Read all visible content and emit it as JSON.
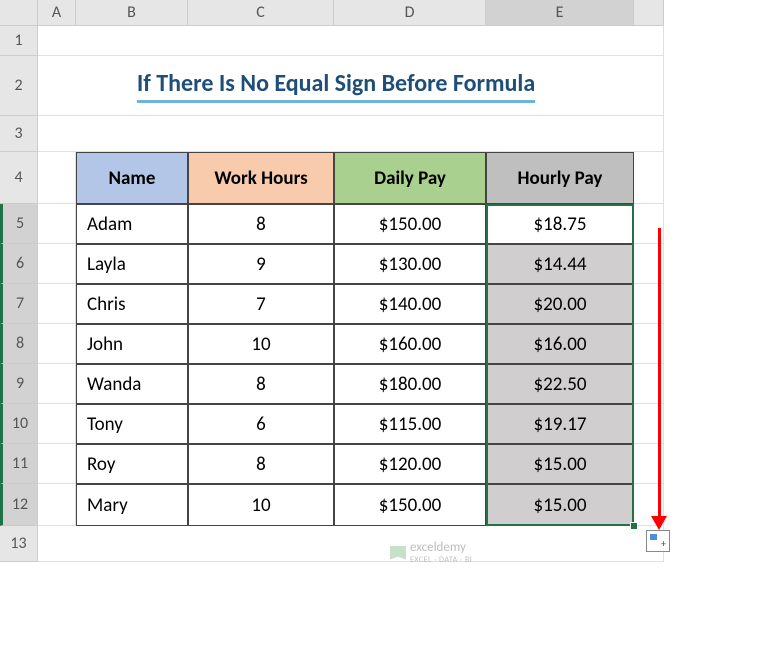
{
  "cols": [
    "A",
    "B",
    "C",
    "D",
    "E",
    ""
  ],
  "rows": [
    "1",
    "2",
    "3",
    "4",
    "5",
    "6",
    "7",
    "8",
    "9",
    "10",
    "11",
    "12",
    "13"
  ],
  "title": "If There Is No Equal Sign Before Formula",
  "headers": {
    "name": "Name",
    "work": "Work Hours",
    "daily": "Daily Pay",
    "hourly": "Hourly Pay"
  },
  "data": [
    {
      "name": "Adam",
      "work": "8",
      "daily": "$150.00",
      "hourly": "$18.75",
      "gray": false
    },
    {
      "name": "Layla",
      "work": "9",
      "daily": "$130.00",
      "hourly": "$14.44",
      "gray": true
    },
    {
      "name": "Chris",
      "work": "7",
      "daily": "$140.00",
      "hourly": "$20.00",
      "gray": true
    },
    {
      "name": "John",
      "work": "10",
      "daily": "$160.00",
      "hourly": "$16.00",
      "gray": true
    },
    {
      "name": "Wanda",
      "work": "8",
      "daily": "$180.00",
      "hourly": "$22.50",
      "gray": true
    },
    {
      "name": "Tony",
      "work": "6",
      "daily": "$115.00",
      "hourly": "$19.17",
      "gray": true
    },
    {
      "name": "Roy",
      "work": "8",
      "daily": "$120.00",
      "hourly": "$15.00",
      "gray": true
    },
    {
      "name": "Mary",
      "work": "10",
      "daily": "$150.00",
      "hourly": "$15.00",
      "gray": true
    }
  ],
  "watermark": {
    "brand": "exceldemy",
    "sub": "EXCEL · DATA · BI"
  }
}
